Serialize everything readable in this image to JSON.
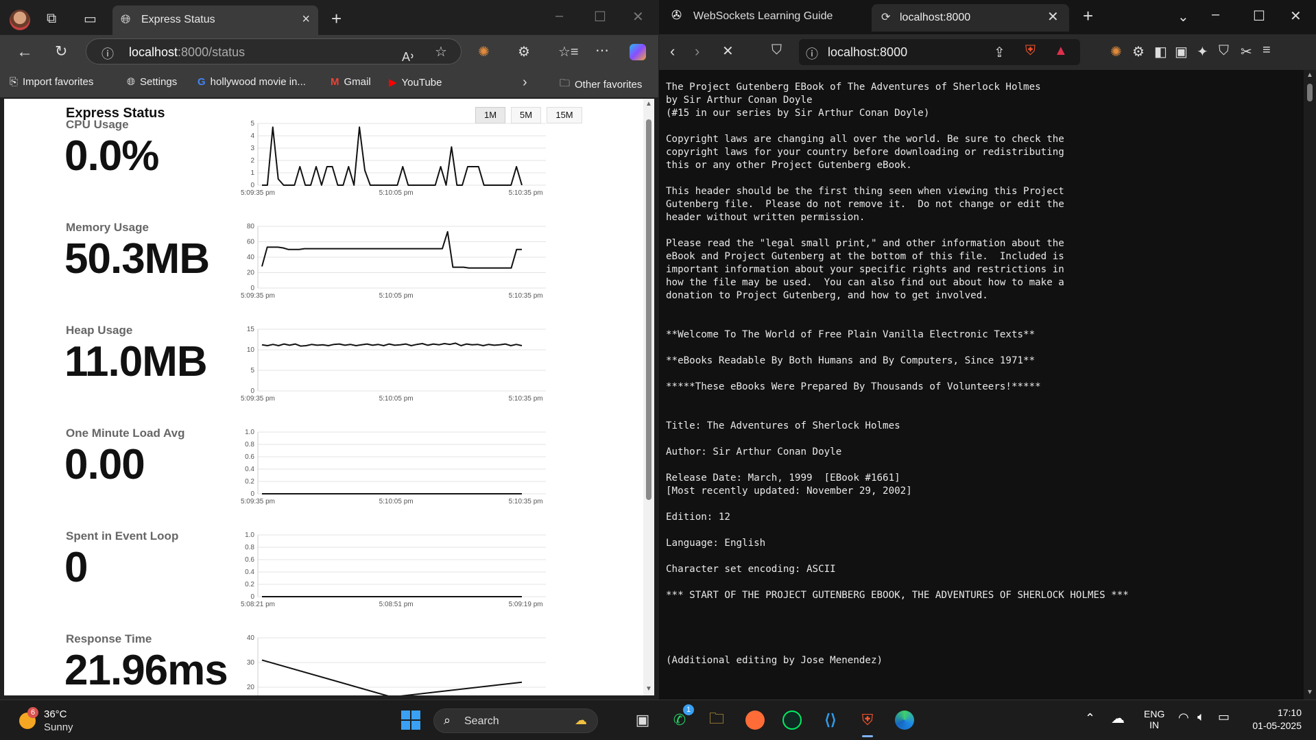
{
  "edge": {
    "tab_title": "Express Status",
    "url_host": "localhost",
    "url_rest": ":8000/status",
    "favorites": [
      {
        "label": "Import favorites",
        "icon": "import-favorites-icon"
      },
      {
        "label": "Settings",
        "icon": "globe-icon"
      },
      {
        "label": "hollywood movie in...",
        "icon": "google-icon"
      },
      {
        "label": "Gmail",
        "icon": "gmail-icon"
      },
      {
        "label": "YouTube",
        "icon": "youtube-icon"
      }
    ],
    "other_favorites": "Other favorites"
  },
  "status_page": {
    "title": "Express Status",
    "ranges": [
      "1M",
      "5M",
      "15M"
    ],
    "active_range": "1M",
    "metrics": [
      {
        "label": "CPU Usage",
        "value": "0.0%",
        "y_ticks": [
          "0",
          "1",
          "2",
          "3",
          "4",
          "5"
        ],
        "y_max": 5,
        "x_ticks": [
          "5:09:35 pm",
          "5:10:05 pm",
          "5:10:35 pm"
        ],
        "points": [
          0,
          0,
          4.7,
          0.5,
          0,
          0,
          0,
          1.5,
          0,
          0,
          1.5,
          0,
          1.5,
          1.5,
          0,
          0,
          1.5,
          0,
          4.7,
          1.2,
          0,
          0,
          0,
          0,
          0,
          0,
          1.5,
          0,
          0,
          0,
          0,
          0,
          0,
          1.5,
          0,
          3.1,
          0,
          0,
          1.5,
          1.5,
          1.5,
          0,
          0,
          0,
          0,
          0,
          0,
          1.5,
          0
        ]
      },
      {
        "label": "Memory Usage",
        "value": "50.3MB",
        "y_ticks": [
          "0",
          "20",
          "40",
          "60",
          "80"
        ],
        "y_max": 80,
        "x_ticks": [
          "5:09:35 pm",
          "5:10:05 pm",
          "5:10:35 pm"
        ],
        "points": [
          28,
          53,
          53,
          53,
          52,
          50,
          50,
          50,
          51,
          51,
          51,
          51,
          51,
          51,
          51,
          51,
          51,
          51,
          51,
          51,
          51,
          51,
          51,
          51,
          51,
          51,
          51,
          51,
          51,
          51,
          51,
          51,
          51,
          51,
          51,
          73,
          27,
          27,
          27,
          26,
          26,
          26,
          26,
          26,
          26,
          26,
          26,
          26,
          50,
          50
        ]
      },
      {
        "label": "Heap Usage",
        "value": "11.0MB",
        "y_ticks": [
          "0",
          "5",
          "10",
          "15"
        ],
        "y_max": 15,
        "x_ticks": [
          "5:09:35 pm",
          "5:10:05 pm",
          "5:10:35 pm"
        ],
        "points": [
          11.2,
          11.0,
          11.3,
          11.0,
          11.4,
          11.1,
          11.4,
          10.9,
          11.0,
          11.3,
          11.1,
          11.2,
          11.0,
          11.3,
          11.4,
          11.1,
          11.3,
          11.0,
          11.2,
          11.4,
          11.1,
          11.3,
          11.0,
          11.4,
          11.1,
          11.2,
          11.4,
          11.0,
          11.3,
          11.5,
          11.1,
          11.4,
          11.2,
          11.5,
          11.3,
          11.6,
          11.0,
          11.4,
          11.2,
          11.3,
          11.0,
          11.3,
          11.1,
          11.2,
          11.4,
          11.0,
          11.3,
          11.0
        ]
      },
      {
        "label": "One Minute Load Avg",
        "value": "0.00",
        "y_ticks": [
          "0",
          "0.2",
          "0.4",
          "0.6",
          "0.8",
          "1.0"
        ],
        "y_max": 1,
        "x_ticks": [
          "5:09:35 pm",
          "5:10:05 pm",
          "5:10:35 pm"
        ],
        "points": [
          0,
          0,
          0,
          0,
          0,
          0,
          0,
          0,
          0,
          0
        ]
      },
      {
        "label": "Spent in Event Loop",
        "value": "0",
        "y_ticks": [
          "0",
          "0.2",
          "0.4",
          "0.6",
          "0.8",
          "1.0"
        ],
        "y_max": 1,
        "x_ticks": [
          "5:08:21 pm",
          "5:08:51 pm",
          "5:09:19 pm"
        ],
        "points": [
          0,
          0,
          0,
          0,
          0,
          0,
          0,
          0,
          0,
          0
        ]
      },
      {
        "label": "Response Time",
        "value": "21.96ms",
        "y_ticks": [
          "20",
          "30",
          "40"
        ],
        "y_min": 15,
        "y_max": 40,
        "x_ticks": [],
        "points": [
          31,
          16,
          22
        ]
      }
    ]
  },
  "brave": {
    "tab1_title": "WebSockets Learning Guide",
    "tab2_title": "localhost:8000",
    "url": "localhost:8000",
    "text_lines": [
      "The Project Gutenberg EBook of The Adventures of Sherlock Holmes",
      "by Sir Arthur Conan Doyle",
      "(#15 in our series by Sir Arthur Conan Doyle)",
      "",
      "Copyright laws are changing all over the world. Be sure to check the",
      "copyright laws for your country before downloading or redistributing",
      "this or any other Project Gutenberg eBook.",
      "",
      "This header should be the first thing seen when viewing this Project",
      "Gutenberg file.  Please do not remove it.  Do not change or edit the",
      "header without written permission.",
      "",
      "Please read the \"legal small print,\" and other information about the",
      "eBook and Project Gutenberg at the bottom of this file.  Included is",
      "important information about your specific rights and restrictions in",
      "how the file may be used.  You can also find out about how to make a",
      "donation to Project Gutenberg, and how to get involved.",
      "",
      "",
      "**Welcome To The World of Free Plain Vanilla Electronic Texts**",
      "",
      "**eBooks Readable By Both Humans and By Computers, Since 1971**",
      "",
      "*****These eBooks Were Prepared By Thousands of Volunteers!*****",
      "",
      "",
      "Title: The Adventures of Sherlock Holmes",
      "",
      "Author: Sir Arthur Conan Doyle",
      "",
      "Release Date: March, 1999  [EBook #1661]",
      "[Most recently updated: November 29, 2002]",
      "",
      "Edition: 12",
      "",
      "Language: English",
      "",
      "Character set encoding: ASCII",
      "",
      "*** START OF THE PROJECT GUTENBERG EBOOK, THE ADVENTURES OF SHERLOCK HOLMES ***",
      "",
      "",
      "",
      "",
      "(Additional editing by Jose Menendez)"
    ]
  },
  "taskbar": {
    "weather_temp": "36°C",
    "weather_desc": "Sunny",
    "weather_badge": "6",
    "search_label": "Search",
    "whatsapp_badge": "1",
    "lang_1": "ENG",
    "lang_2": "IN",
    "time": "17:10",
    "date": "01-05-2025"
  }
}
